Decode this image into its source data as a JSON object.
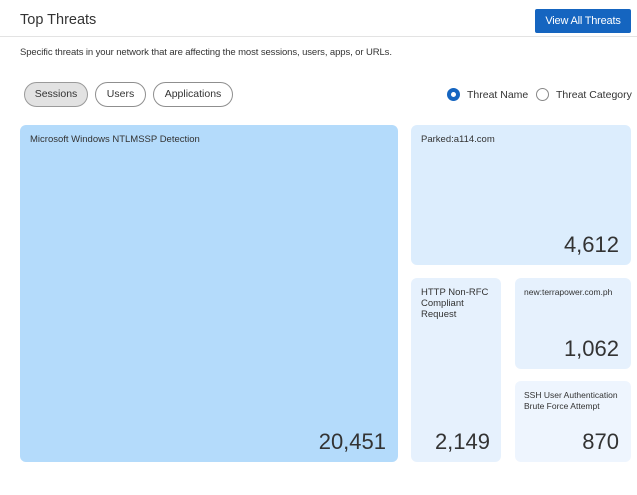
{
  "header": {
    "title": "Top Threats",
    "view_all_label": "View All Threats"
  },
  "subtitle": "Specific threats in your network that are affecting the most sessions, users, apps, or URLs.",
  "filters": {
    "buttons": [
      {
        "label": "Sessions",
        "active": true
      },
      {
        "label": "Users",
        "active": false
      },
      {
        "label": "Applications",
        "active": false
      }
    ],
    "radios": [
      {
        "label": "Threat Name",
        "checked": true
      },
      {
        "label": "Threat Category",
        "checked": false
      }
    ]
  },
  "threats": [
    {
      "name": "Microsoft Windows NTLMSSP Detection",
      "value": "20,451"
    },
    {
      "name": "Parked:a114.com",
      "value": "4,612"
    },
    {
      "name": "HTTP Non-RFC Compliant Request",
      "value": "2,149"
    },
    {
      "name": "new:terrapower.com.ph",
      "value": "1,062"
    },
    {
      "name": "SSH User Authentication Brute Force Attempt",
      "value": "870"
    }
  ],
  "colors": {
    "accent": "#1565c0",
    "tile_largest": "#b4dbfb",
    "tile_large": "#dcedfd",
    "tile_medium": "#e6f1fd",
    "tile_small": "#eef5fe"
  }
}
